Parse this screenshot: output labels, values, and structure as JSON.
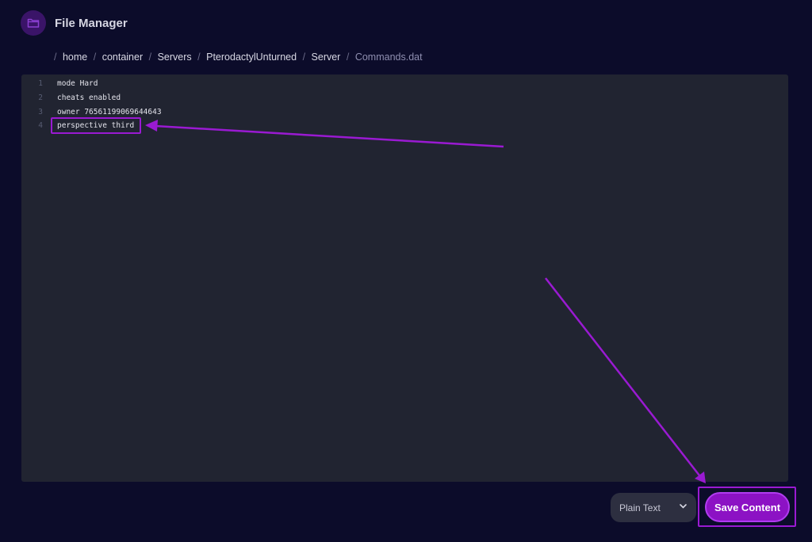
{
  "header": {
    "title": "File Manager",
    "icon": "folder-icon"
  },
  "breadcrumb": {
    "items": [
      "home",
      "container",
      "Servers",
      "PterodactylUnturned",
      "Server"
    ],
    "current": "Commands.dat",
    "separator": "/"
  },
  "editor": {
    "lines": [
      {
        "num": "1",
        "text": "mode Hard"
      },
      {
        "num": "2",
        "text": "cheats enabled"
      },
      {
        "num": "3",
        "text": "owner 76561199069644643"
      },
      {
        "num": "4",
        "text": "perspective third"
      }
    ]
  },
  "footer": {
    "mode_select": {
      "value": "Plain Text"
    },
    "save_label": "Save Content"
  },
  "colors": {
    "background": "#0c0c2a",
    "editor_bg": "#212431",
    "accent": "#8c12c4",
    "annotation": "#9a1ad2"
  }
}
